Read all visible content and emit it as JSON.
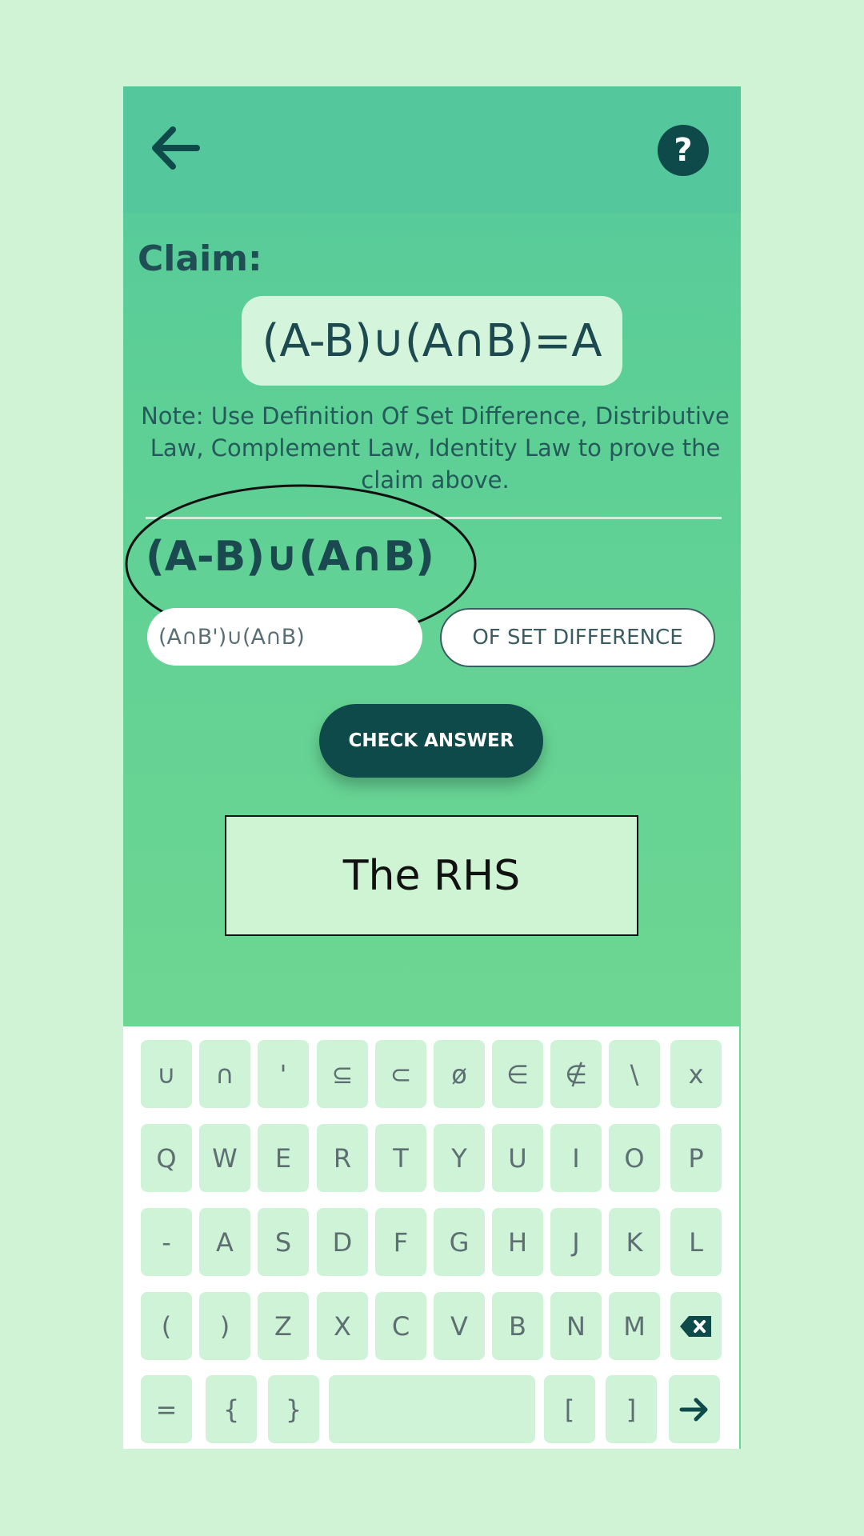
{
  "header": {
    "back_icon": "arrow-left-icon",
    "help_label": "?"
  },
  "claim": {
    "label": "Claim:",
    "statement": "(A-B)∪(A∩B)=A"
  },
  "note": "Note: Use Definition Of Set Difference, Distributive Law, Complement Law, Identity Law to prove the claim above.",
  "step": {
    "expression": "(A-B)∪(A∩B)",
    "input_value": "(A∩B')∪(A∩B)",
    "law_select": "OF SET DIFFERENCE"
  },
  "check_button": "CHECK ANSWER",
  "result_label": "The RHS",
  "keyboard": {
    "row1": [
      "∪",
      "∩",
      "'",
      "⊆",
      "⊂",
      "ø",
      "∈",
      "∉",
      "\\",
      "x"
    ],
    "row2": [
      "Q",
      "W",
      "E",
      "R",
      "T",
      "Y",
      "U",
      "I",
      "O",
      "P"
    ],
    "row3": [
      "-",
      "A",
      "S",
      "D",
      "F",
      "G",
      "H",
      "J",
      "K",
      "L"
    ],
    "row4": [
      "(",
      ")",
      "Z",
      "X",
      "C",
      "V",
      "B",
      "N",
      "M"
    ],
    "row5": [
      "=",
      "{",
      "}",
      "",
      "[",
      "]"
    ],
    "backspace_icon": "backspace-icon",
    "enter_icon": "arrow-right-icon"
  },
  "colors": {
    "accent": "#0e4a4a",
    "background": "#cff3d4",
    "panel": "#5ccf96"
  }
}
